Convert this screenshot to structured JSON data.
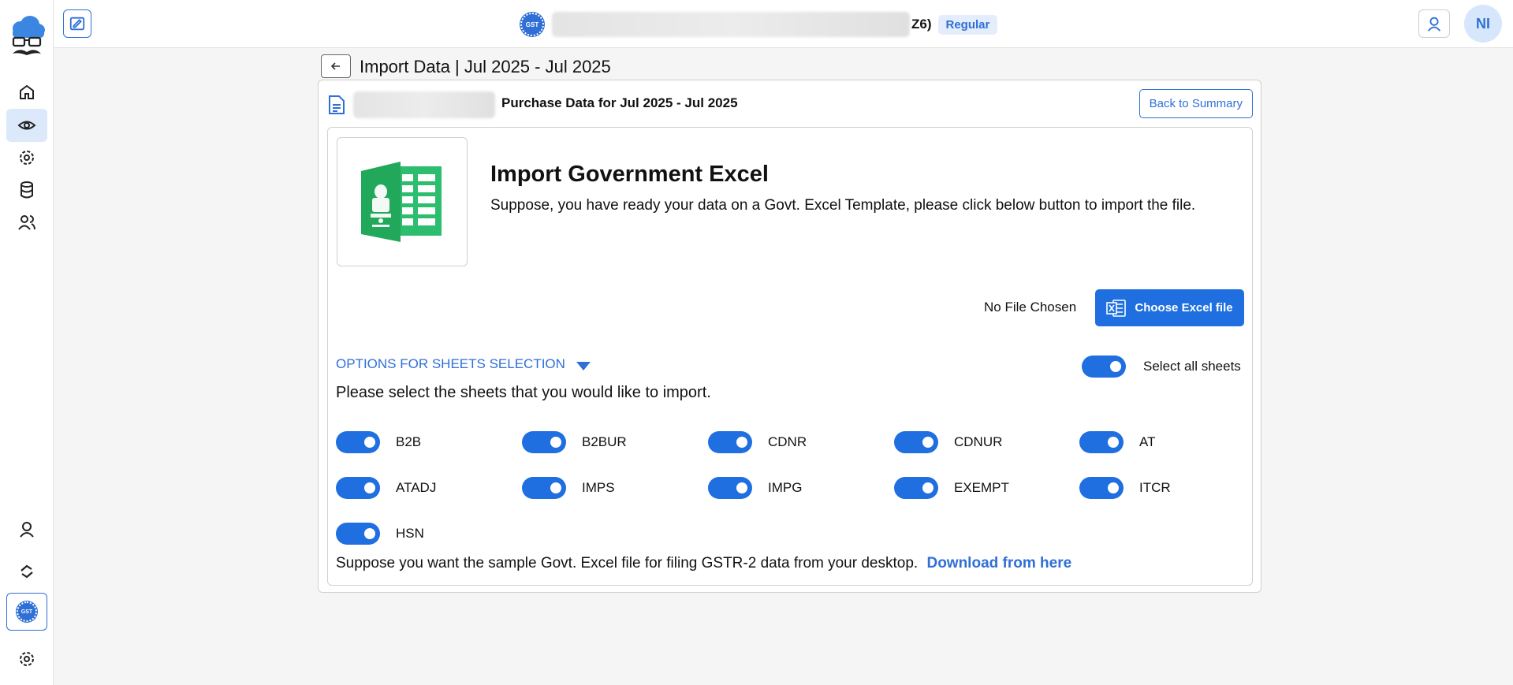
{
  "topbar": {
    "gst_seal_text": "GST",
    "taxpayer_suffix": "Z6)",
    "badge": "Regular",
    "avatar": "NI"
  },
  "header": {
    "title": "Import Data | Jul 2025 - Jul 2025"
  },
  "card": {
    "title": "Purchase Data for Jul 2025 - Jul 2025",
    "back_to_summary": "Back to Summary"
  },
  "import": {
    "title": "Import Government Excel",
    "description": "Suppose, you have ready your data on a Govt. Excel Template, please click below button to import the file.",
    "file_status": "No File Chosen",
    "choose_button": "Choose Excel file"
  },
  "sheets_section": {
    "options_label": "OPTIONS FOR SHEETS SELECTION",
    "select_all_label": "Select all sheets",
    "select_all_on": true,
    "instruction": "Please select the sheets that you would like to import.",
    "sheets": [
      {
        "label": "B2B",
        "on": true
      },
      {
        "label": "B2BUR",
        "on": true
      },
      {
        "label": "CDNR",
        "on": true
      },
      {
        "label": "CDNUR",
        "on": true
      },
      {
        "label": "AT",
        "on": true
      },
      {
        "label": "ATADJ",
        "on": true
      },
      {
        "label": "IMPS",
        "on": true
      },
      {
        "label": "IMPG",
        "on": true
      },
      {
        "label": "EXEMPT",
        "on": true
      },
      {
        "label": "ITCR",
        "on": true
      },
      {
        "label": "HSN",
        "on": true
      }
    ]
  },
  "footer": {
    "text": "Suppose you want the sample Govt. Excel file for filing GSTR-2 data from your desktop.",
    "link": "Download from here"
  },
  "colors": {
    "accent": "#1f6fe0",
    "excel_green": "#2dbd6e"
  }
}
